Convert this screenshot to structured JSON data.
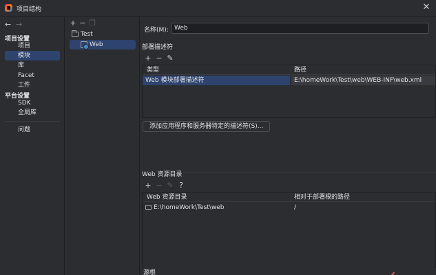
{
  "window": {
    "title": "项目结构"
  },
  "nav": {
    "project_settings_label": "项目设置",
    "project_settings_items": [
      {
        "label": "项目"
      },
      {
        "label": "模块"
      },
      {
        "label": "库"
      },
      {
        "label": "Facet"
      },
      {
        "label": "工件"
      }
    ],
    "platform_settings_label": "平台设置",
    "platform_settings_items": [
      {
        "label": "SDK"
      },
      {
        "label": "全局库"
      }
    ],
    "problems_label": "问题"
  },
  "module_tree": {
    "items": [
      {
        "label": "Test"
      },
      {
        "label": "Web"
      }
    ]
  },
  "details": {
    "name_label": "名称(M):",
    "name_value": "Web",
    "deployment_descriptors": {
      "title": "部署描述符",
      "columns": [
        "类型",
        "路径"
      ],
      "rows": [
        {
          "type": "Web 模块部署描述符",
          "path": "E:\\homeWork\\Test\\web\\WEB-INF\\web.xml"
        }
      ],
      "add_button": "添加应用程序和服务器特定的描述符(S)..."
    },
    "web_resource_directories": {
      "title": "Web 资源目录",
      "columns": [
        "Web 资源目录",
        "相对于部署根的路径"
      ],
      "rows": [
        {
          "dir": "E:\\homeWork\\Test\\web",
          "relative": "/"
        }
      ]
    },
    "source_roots_label": "源根"
  }
}
